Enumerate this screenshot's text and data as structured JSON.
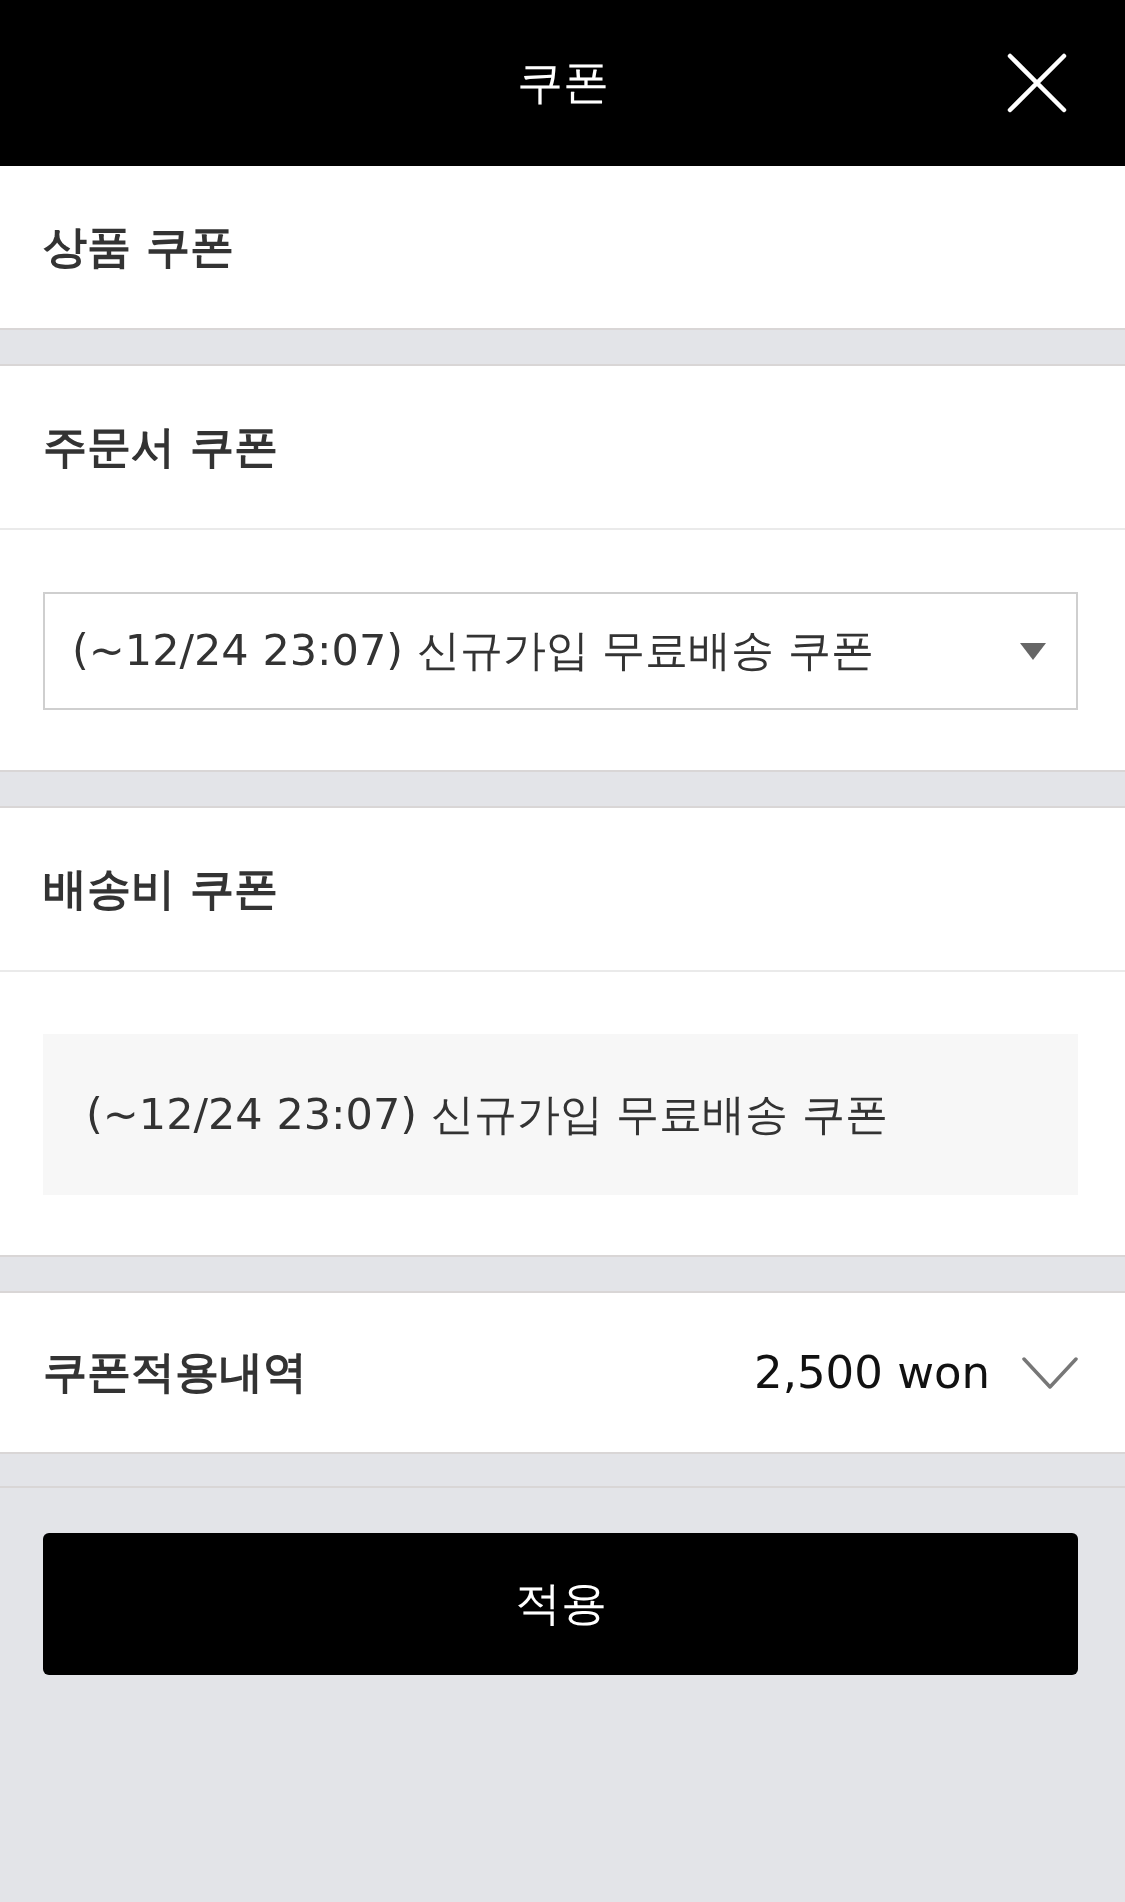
{
  "header": {
    "title": "쿠폰"
  },
  "sections": [
    {
      "kind": "empty",
      "title": "상품 쿠폰"
    },
    {
      "kind": "select",
      "title": "주문서 쿠폰",
      "value": "(~12/24 23:07) 신규가입 무료배송 쿠폰"
    },
    {
      "kind": "fixed",
      "title": "배송비 쿠폰",
      "value": "(~12/24 23:07) 신규가입 무료배송 쿠폰"
    }
  ],
  "summary": {
    "label": "쿠폰적용내역",
    "amount": "2,500 won",
    "expanded": false
  },
  "apply_button": {
    "label": "적용"
  }
}
